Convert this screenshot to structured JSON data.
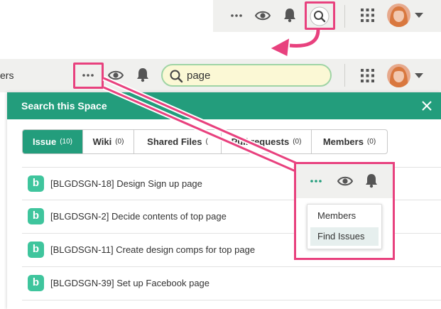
{
  "top_bar": {
    "more_icon": "more-dots-icon",
    "watch_icon": "eye-icon",
    "notification_icon": "bell-icon",
    "search_icon": "search-icon",
    "apps_icon": "grid-icon"
  },
  "second_bar": {
    "breadcrumb_fragment": "ers",
    "search_value": "page"
  },
  "panel": {
    "title": "Search this Space",
    "close_icon": "close-icon",
    "tabs": [
      {
        "label": "Issue",
        "count": "(10)",
        "active": true
      },
      {
        "label": "Wiki",
        "count": "(0)",
        "active": false
      },
      {
        "label": "Shared Files",
        "count": "(",
        "active": false
      },
      {
        "label": "Pull requests",
        "count": "(0)",
        "active": false
      },
      {
        "label": "Members",
        "count": "(0)",
        "active": false
      }
    ],
    "results": [
      {
        "badge": "b",
        "text": "[BLGDSGN-18] Design Sign up page"
      },
      {
        "badge": "b",
        "text": "[BLGDSGN-2] Decide contents of top page"
      },
      {
        "badge": "b",
        "text": "[BLGDSGN-11] Create design comps for top page"
      },
      {
        "badge": "b",
        "text": "[BLGDSGN-39] Set up Facebook page"
      }
    ]
  },
  "popup": {
    "menu": [
      {
        "label": "Members"
      },
      {
        "label": "Find Issues"
      }
    ]
  },
  "colors": {
    "accent": "#239d7c",
    "highlight": "#e8417e",
    "badge": "#3fc59d",
    "bar": "#f0f0ee"
  }
}
